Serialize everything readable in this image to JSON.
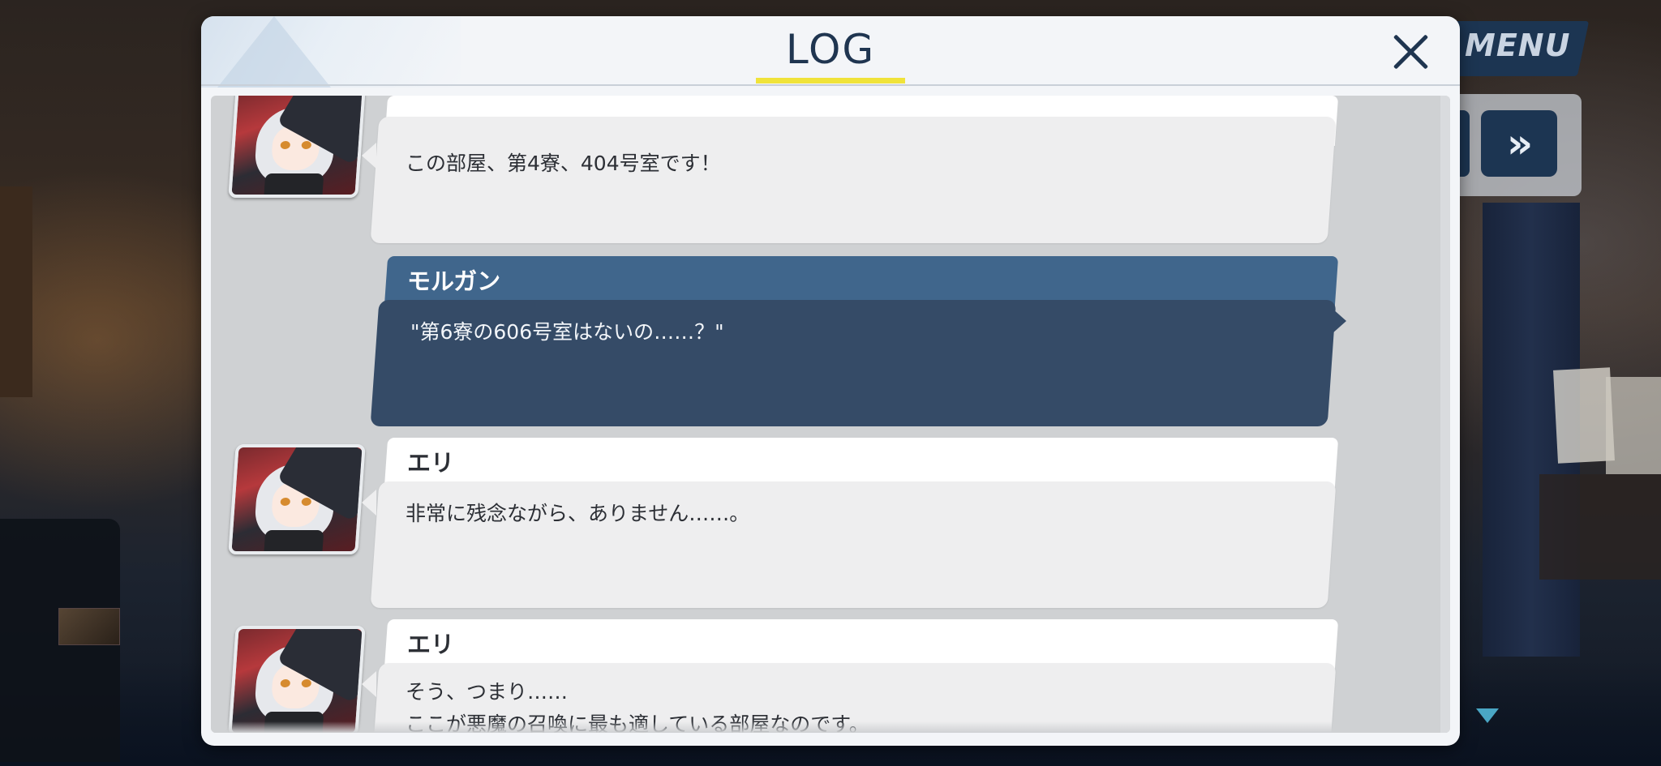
{
  "hud": {
    "menu_label": "MENU",
    "fast_forward_icon": "fast-forward-icon",
    "fast_forward_glyph": "»",
    "scroll_indicator_icon": "triangle-down-icon"
  },
  "log": {
    "title": "LOG",
    "close_icon": "close-icon",
    "entries": [
      {
        "speaker": "",
        "text": "この部屋、第4寮、404号室です！",
        "style": "light",
        "has_avatar": true
      },
      {
        "speaker": "モルガン",
        "text": "\"第6寮の606号室はないの……？\"",
        "style": "dark",
        "has_avatar": false
      },
      {
        "speaker": "エリ",
        "text": "非常に残念ながら、ありません……。",
        "style": "light",
        "has_avatar": true
      },
      {
        "speaker": "エリ",
        "text": "そう、つまり……\nここが悪魔の召喚に最も適している部屋なのです。",
        "style": "light",
        "has_avatar": true
      }
    ]
  },
  "colors": {
    "accent_underline": "#f0e33a",
    "navy": "#1f3550",
    "player_name_bar": "#40668c",
    "player_body": "#354b67"
  }
}
